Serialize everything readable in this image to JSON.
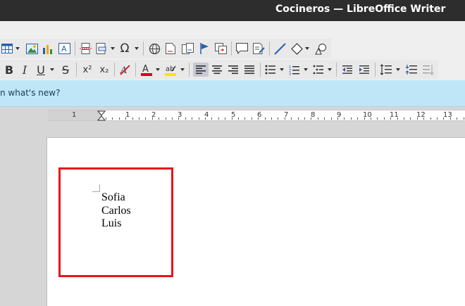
{
  "window": {
    "title": "Cocineros — LibreOffice Writer"
  },
  "infobar": {
    "text": "n what's new?"
  },
  "ruler": {
    "labels": [
      "1",
      "1",
      "2",
      "3",
      "4",
      "5",
      "6",
      "7",
      "8",
      "9",
      "10",
      "11",
      "12",
      "13"
    ]
  },
  "toolbar": {
    "row1_icons": [
      "table-icon",
      "image-icon",
      "chart-icon",
      "text-box-icon",
      "page-break-icon",
      "field-icon",
      "special-character-icon",
      "hyperlink-icon",
      "footnote-icon",
      "endnote-icon",
      "bookmark-icon",
      "cross-reference-icon",
      "comment-icon",
      "track-changes-icon",
      "line-icon",
      "shapes-icon",
      "draw-icon"
    ],
    "row2_icons": [
      "bold-icon",
      "italic-icon",
      "underline-icon",
      "strikethrough-icon",
      "superscript-icon",
      "subscript-icon",
      "clear-formatting-icon",
      "font-color-icon",
      "highlight-icon",
      "align-left-icon",
      "align-center-icon",
      "align-right-icon",
      "justify-icon",
      "bullet-list-icon",
      "numbered-list-icon",
      "outline-icon",
      "decrease-indent-icon",
      "increase-indent-icon",
      "line-spacing-icon",
      "paragraph-spacing-icon",
      "paragraph-spacing-disabled-icon"
    ],
    "bold_label": "B",
    "italic_label": "I",
    "underline_label": "U",
    "strike_label": "S",
    "superscript_label": "x²",
    "subscript_label": "x₂",
    "special_char_label": "Ω"
  },
  "document": {
    "lines": [
      "Sofia",
      "Carlos",
      "Luis"
    ]
  },
  "colors": {
    "highlight_border": "#e8141a",
    "infobar_bg": "#bfe6f7",
    "font_color_bar": "#d9001b",
    "highlight_bar": "#f7e600"
  }
}
